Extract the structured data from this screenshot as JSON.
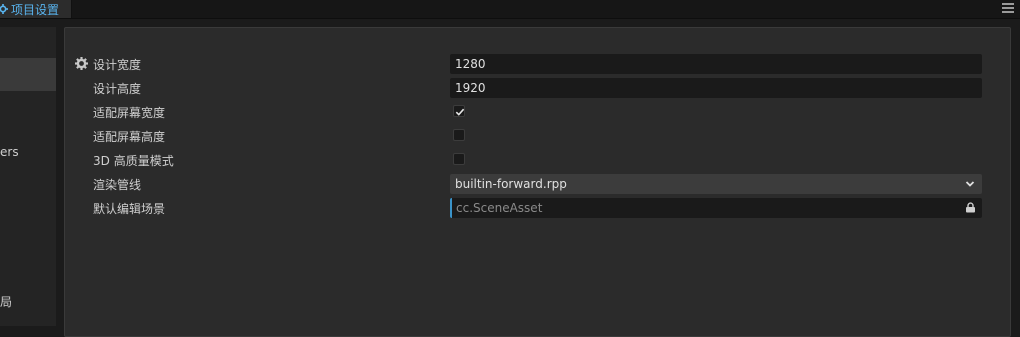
{
  "tab": {
    "title": "项目设置",
    "icon": "gear-icon"
  },
  "sidebar": {
    "items": [
      {
        "label": "",
        "active": true
      },
      {
        "label": "ers"
      },
      {
        "label": "局"
      }
    ]
  },
  "settings": {
    "design_width": {
      "label": "设计宽度",
      "value": "1280"
    },
    "design_height": {
      "label": "设计高度",
      "value": "1920"
    },
    "fit_width": {
      "label": "适配屏幕宽度",
      "checked": true
    },
    "fit_height": {
      "label": "适配屏幕高度",
      "checked": false
    },
    "hq_mode": {
      "label": "3D 高质量模式",
      "checked": false
    },
    "render_pipeline": {
      "label": "渲染管线",
      "value": "builtin-forward.rpp"
    },
    "default_scene": {
      "label": "默认编辑场景",
      "placeholder": "cc.SceneAsset"
    }
  },
  "colors": {
    "accent": "#58b3ee",
    "asset_border": "#3a93c9",
    "panel_bg": "#2b2b2b"
  }
}
